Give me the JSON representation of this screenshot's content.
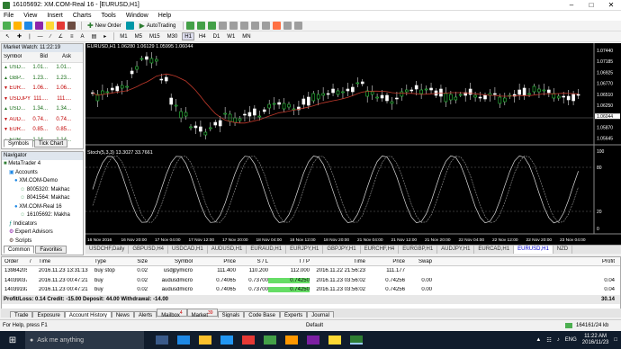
{
  "window": {
    "title": "16105692: XM.COM-Real 16 - [EURUSD,H1]"
  },
  "menu": [
    "File",
    "View",
    "Insert",
    "Charts",
    "Tools",
    "Window",
    "Help"
  ],
  "toolbar": {
    "new_order": "New Order",
    "autotrading": "AutoTrading",
    "timeframes": [
      "M1",
      "M5",
      "M15",
      "M30",
      "H1",
      "H4",
      "D1",
      "W1",
      "MN"
    ]
  },
  "market_watch": {
    "title": "Market Watch: 11:22:19",
    "headers": [
      "Symbol",
      "Bid",
      "Ask"
    ],
    "rows": [
      {
        "symbol": "USD...",
        "bid": "1.01...",
        "ask": "1.01...",
        "color": "#1a6e1a"
      },
      {
        "symbol": "GBP...",
        "bid": "1.23...",
        "ask": "1.23...",
        "color": "#1a6e1a"
      },
      {
        "symbol": "EUR...",
        "bid": "1.06...",
        "ask": "1.06...",
        "color": "#c00000"
      },
      {
        "symbol": "USDJPY",
        "bid": "111....",
        "ask": "111....",
        "color": "#c00000"
      },
      {
        "symbol": "USD...",
        "bid": "1.34...",
        "ask": "1.34...",
        "color": "#1a6e1a"
      },
      {
        "symbol": "AUD...",
        "bid": "0.74...",
        "ask": "0.74...",
        "color": "#c00000"
      },
      {
        "symbol": "EUR...",
        "bid": "0.85...",
        "ask": "0.85...",
        "color": "#c00000"
      },
      {
        "symbol": "EUR...",
        "bid": "1.14...",
        "ask": "1.14...",
        "color": "#1a6e1a"
      }
    ],
    "tabs": [
      "Symbols",
      "Tick Chart"
    ]
  },
  "navigator": {
    "title": "Navigator",
    "items": [
      {
        "label": "MetaTrader 4",
        "indent": 0
      },
      {
        "label": "Accounts",
        "indent": 1
      },
      {
        "label": "XM.COM-Demo",
        "indent": 2
      },
      {
        "label": "8005320: Makhac",
        "indent": 3
      },
      {
        "label": "8041564: Makhac",
        "indent": 3
      },
      {
        "label": "XM.COM-Real 16",
        "indent": 2
      },
      {
        "label": "16105692: Makha",
        "indent": 3
      },
      {
        "label": "Indicators",
        "indent": 1
      },
      {
        "label": "Expert Advisors",
        "indent": 1
      },
      {
        "label": "Scripts",
        "indent": 1
      }
    ],
    "tabs": [
      "Common",
      "Favorites"
    ]
  },
  "chart": {
    "label": "EURUSD,H1  1.06280 1.06129 1.05995 1.06044",
    "price_labels": [
      "1.07440",
      "1.07185",
      "1.06925",
      "1.06770",
      "1.06510",
      "1.06250",
      "1.06044",
      "1.05870",
      "1.05645"
    ],
    "stoch_label": "Stoch(5,3,3) 13.3027 33.7661",
    "stoch_levels": [
      "100",
      "80",
      "20",
      "0"
    ],
    "time_labels": [
      "16 Nov 2016",
      "16 Nov 20:00",
      "17 Nov 04:00",
      "17 Nov 12:00",
      "17 Nov 20:00",
      "18 Nov 04:00",
      "18 Nov 12:00",
      "18 Nov 20:00",
      "21 Nov 04:00",
      "21 Nov 12:00",
      "21 Nov 20:00",
      "22 Nov 04:00",
      "22 Nov 12:00",
      "22 Nov 20:00",
      "23 Nov 04:00"
    ],
    "tabs": [
      "USDCHF,Daily",
      "GBPUSD,H4",
      "USDCAD,H1",
      "AUDUSD,H1",
      "EURAUD,H1",
      "EURJPY,H1",
      "GBPJPY,H1",
      "EURCHF,H4",
      "EURGBP,H1",
      "AUDJPY,H1",
      "EURCAD,H1",
      "EURUSD,H1",
      "NZD"
    ],
    "active_tab": "EURUSD,H1"
  },
  "terminal": {
    "headers": [
      "Order",
      "/",
      "Time",
      "Type",
      "Size",
      "Symbol",
      "Price",
      "S / L",
      "T / P",
      "Time",
      "Price",
      "Swap",
      "Profit"
    ],
    "rows": [
      [
        "13984205",
        "",
        "2016.11.23 13:31:13",
        "buy stop",
        "0.02",
        "usdjpymicro",
        "111.400",
        "110.200",
        "112.000",
        "2016.11.22 21:56:23",
        "111.177",
        "",
        ""
      ],
      [
        "14039037",
        "",
        "2016.11.23 00:47:21",
        "buy",
        "0.02",
        "audusdmicro",
        "0.74065",
        "0.73700",
        "0.74250",
        "2016.11.23 03:56:02",
        "0.74256",
        "0.00",
        "0.04"
      ],
      [
        "14039192",
        "",
        "2016.11.23 00:47:21",
        "buy",
        "0.02",
        "audusdmicro",
        "0.74065",
        "0.73700",
        "0.74250",
        "2016.11.23 03:56:02",
        "0.74256",
        "0.00",
        "0.04"
      ]
    ],
    "summary": "Profit/Loss: 0.14  Credit: -15.00  Deposit: 44.00  Withdrawal: -14.00",
    "summary_value": "30.14",
    "tabs": [
      "Trade",
      "Exposure",
      "Account History",
      "News",
      "Alerts",
      "Mailbox",
      "Market",
      "Signals",
      "Code Base",
      "Experts",
      "Journal"
    ],
    "active_tab": "Account History",
    "mailbox_badge": "4",
    "market_badge": "39"
  },
  "status": {
    "help": "For Help, press F1",
    "profile": "Default",
    "traffic": "164161/24 kb"
  },
  "taskbar": {
    "search": "Ask me anything",
    "time": "11:22 AM",
    "date": "2016/11/23",
    "lang": "ENG"
  }
}
